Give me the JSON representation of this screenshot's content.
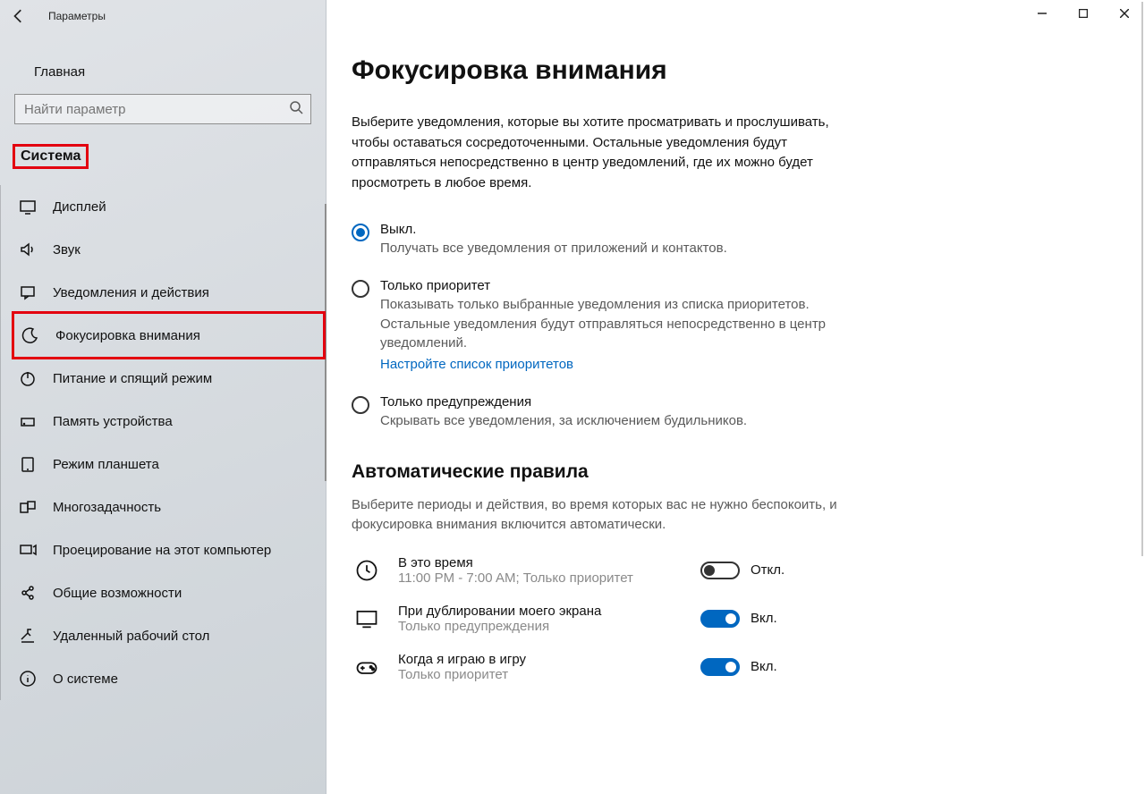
{
  "window": {
    "title": "Параметры"
  },
  "sidebar": {
    "home": "Главная",
    "search_placeholder": "Найти параметр",
    "category": "Система",
    "items": [
      {
        "label": "Дисплей"
      },
      {
        "label": "Звук"
      },
      {
        "label": "Уведомления и действия"
      },
      {
        "label": "Фокусировка внимания"
      },
      {
        "label": "Питание и спящий режим"
      },
      {
        "label": "Память устройства"
      },
      {
        "label": "Режим планшета"
      },
      {
        "label": "Многозадачность"
      },
      {
        "label": "Проецирование на этот компьютер"
      },
      {
        "label": "Общие возможности"
      },
      {
        "label": "Удаленный рабочий стол"
      },
      {
        "label": "О системе"
      }
    ]
  },
  "main": {
    "title": "Фокусировка внимания",
    "intro": "Выберите уведомления, которые вы хотите просматривать и прослушивать, чтобы оставаться сосредоточенными. Остальные уведомления будут отправляться непосредственно в центр уведомлений, где их можно будет просмотреть в любое время.",
    "radios": [
      {
        "title": "Выкл.",
        "desc": "Получать все уведомления от приложений и контактов.",
        "selected": true
      },
      {
        "title": "Только приоритет",
        "desc": "Показывать только выбранные уведомления из списка приоритетов. Остальные уведомления будут отправляться непосредственно в центр уведомлений.",
        "link": "Настройте список приоритетов"
      },
      {
        "title": "Только предупреждения",
        "desc": "Скрывать все уведомления, за исключением будильников."
      }
    ],
    "auto": {
      "heading": "Автоматические правила",
      "intro": "Выберите периоды и действия, во время которых вас не нужно беспокоить, и фокусировка внимания включится автоматически.",
      "rules": [
        {
          "title": "В это время",
          "sub": "11:00 PM - 7:00 AM; Только приоритет",
          "on": false,
          "state": "Откл."
        },
        {
          "title": "При дублировании моего экрана",
          "sub": "Только предупреждения",
          "on": true,
          "state": "Вкл."
        },
        {
          "title": "Когда я играю в игру",
          "sub": "Только приоритет",
          "on": true,
          "state": "Вкл."
        }
      ]
    }
  }
}
